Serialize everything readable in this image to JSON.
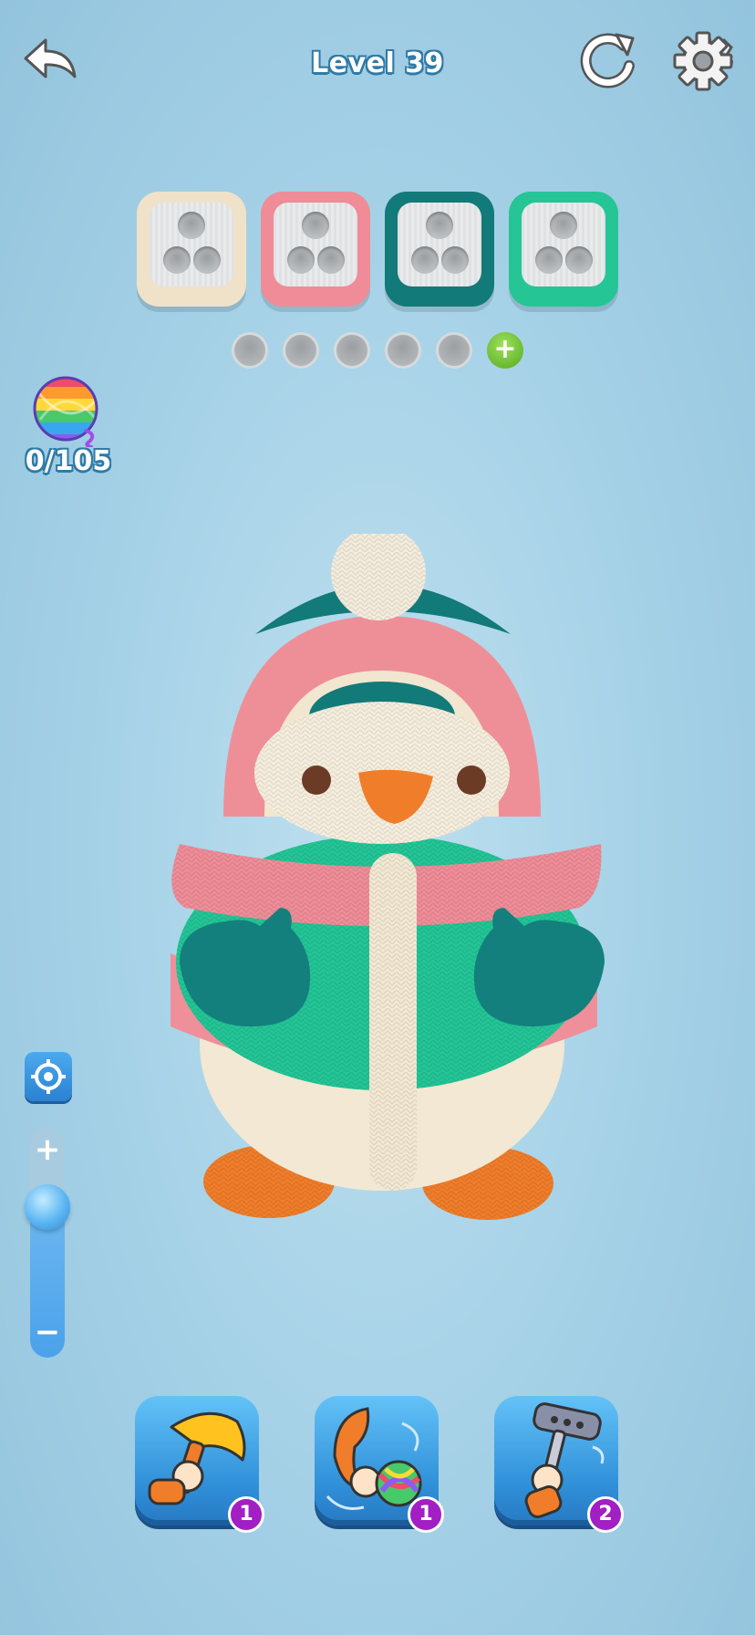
{
  "header": {
    "back_icon": "back-arrow-icon",
    "level_label": "Level 39",
    "restart_icon": "restart-icon",
    "settings_icon": "gear-icon"
  },
  "yarn_boxes": [
    {
      "name": "cream",
      "color": "#efe2c9"
    },
    {
      "name": "pink",
      "color": "#ef8c97"
    },
    {
      "name": "dark-teal",
      "color": "#137a7a"
    },
    {
      "name": "mint",
      "color": "#25c596"
    }
  ],
  "slots": {
    "empty_count": 5,
    "add_icon": "plus-icon"
  },
  "yarn_counter": {
    "value": "0/105",
    "icon": "yarn-ball-icon"
  },
  "zoom": {
    "plus_label": "+",
    "minus_label": "−",
    "focus_icon": "target-icon",
    "level": 0.1
  },
  "boosters": [
    {
      "name": "hammer-hand",
      "icon": "hammer-icon",
      "count": "1"
    },
    {
      "name": "yarn-grab",
      "icon": "yarn-hand-icon",
      "count": "1"
    },
    {
      "name": "lint-roller",
      "icon": "roller-icon",
      "count": "2"
    }
  ],
  "colors": {
    "accent_blue": "#2f8fd8",
    "badge_purple": "#a21fc4",
    "text_outline": "#2f7aa6",
    "add_green": "#64b52c"
  }
}
